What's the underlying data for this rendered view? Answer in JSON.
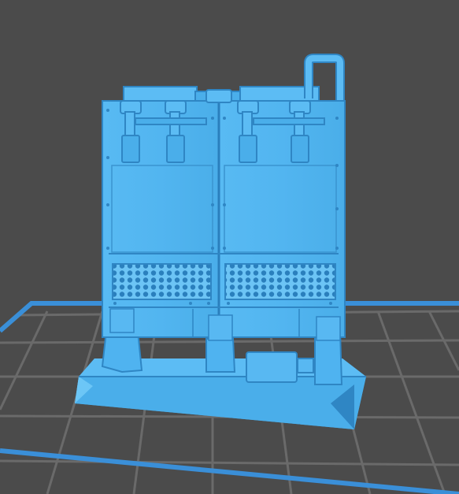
{
  "scene": {
    "kind": "3d-print-slicer-preview",
    "background_color": "#4b4b4b",
    "grid_color": "#6a6a6a",
    "bed_edge_color": "#3a8fd8",
    "model_color": "#4fb3f0",
    "model_shadow_color": "#2f86c4",
    "model_highlight_color": "#8fd3fb",
    "subject": "bulkhead-door-wall-terrain-piece"
  }
}
